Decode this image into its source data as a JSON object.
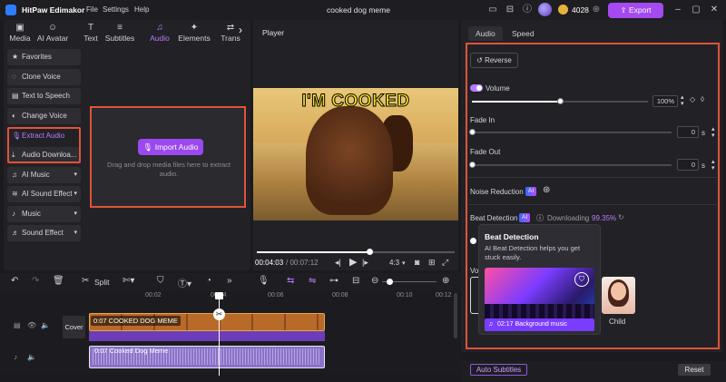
{
  "app": {
    "name": "HitPaw Edimakor",
    "menus": [
      "File",
      "Settings",
      "Help"
    ],
    "project_title": "cooked dog meme",
    "credits": "4028",
    "export_label": "Export"
  },
  "media_tabs": [
    {
      "label": "Media",
      "icon": "media-icon"
    },
    {
      "label": "AI Avatar",
      "icon": "ai-avatar-icon"
    },
    {
      "label": "Text",
      "icon": "text-icon"
    },
    {
      "label": "Subtitles",
      "icon": "subtitles-icon"
    },
    {
      "label": "Audio",
      "icon": "audio-icon",
      "active": true
    },
    {
      "label": "Elements",
      "icon": "elements-icon"
    },
    {
      "label": "Trans",
      "icon": "transitions-icon"
    }
  ],
  "audio_sidebar": [
    {
      "label": "Favorites",
      "icon": "star-icon"
    },
    {
      "label": "Clone Voice",
      "icon": "clone-voice-icon"
    },
    {
      "label": "Text to Speech",
      "icon": "text-to-speech-icon"
    },
    {
      "label": "Change Voice",
      "icon": "change-voice-icon"
    },
    {
      "label": "Extract Audio",
      "icon": "microphone-icon",
      "active": true
    },
    {
      "label": "Audio Downloa...",
      "icon": "download-icon"
    },
    {
      "label": "AI Music",
      "icon": "ai-music-icon",
      "dropdown": true
    },
    {
      "label": "AI Sound Effect",
      "icon": "ai-sound-effect-icon",
      "dropdown": true
    },
    {
      "label": "Music",
      "icon": "music-icon",
      "dropdown": true
    },
    {
      "label": "Sound Effect",
      "icon": "sound-effect-icon",
      "dropdown": true
    }
  ],
  "import": {
    "button_label": "Import Audio",
    "hint": "Drag and drop media files here to extract audio."
  },
  "player": {
    "title": "Player",
    "caption": "I'M COOKED",
    "current_time": "00:04:03",
    "total_time": "/ 00:07:12",
    "progress": 0.57,
    "aspect": "4:3"
  },
  "right_tabs": [
    {
      "label": "Audio",
      "active": true
    },
    {
      "label": "Speed"
    }
  ],
  "audio_settings": {
    "reverse_label": "Reverse",
    "volume_label": "Volume",
    "volume_value": "100%",
    "volume_level": 0.5,
    "fade_in_label": "Fade In",
    "fade_in_value": "0",
    "fade_out_label": "Fade Out",
    "fade_out_value": "0",
    "unit_s": "s",
    "noise_reduction_label": "Noise Reduction",
    "beat_detection_label": "Beat Detection",
    "ai_badge": "AI",
    "downloading_label": "Downloading",
    "downloading_percent": "99.35%",
    "voice_label": "Vo",
    "child_label": "Child"
  },
  "tooltip": {
    "title": "Beat Detection",
    "body": "AI Beat Detection helps you get stuck easily.",
    "music_label": "02:17  Background music"
  },
  "timeline_toolbar": {
    "split_label": "Split"
  },
  "ruler_ticks": [
    "00:02",
    "00:04",
    "00:06",
    "00:08",
    "00:10",
    "00:12"
  ],
  "tracks": {
    "cover_label": "Cover",
    "video_clip_label": "0:07 COOKED DOG MEME",
    "audio_clip_label": "0:07 Cooked Dog Meme"
  },
  "bottom": {
    "auto_subtitles_label": "Auto Subtitles",
    "reset_label": "Reset"
  }
}
